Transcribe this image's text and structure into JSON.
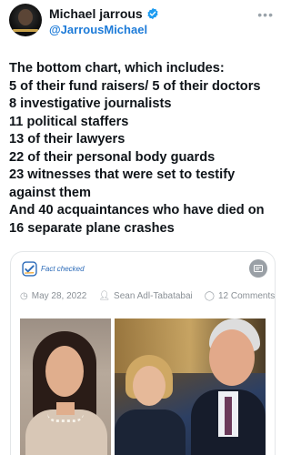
{
  "author": {
    "name": "Michael jarrous",
    "handle": "@JarrousMichael",
    "verified": true,
    "more_icon": "ellipsis-icon"
  },
  "tweet": {
    "lines": [
      "The bottom chart, which includes:",
      "5 of their fund raisers/ 5 of their doctors",
      "8 investigative journalists",
      "11 political staffers",
      "13 of their lawyers",
      "22 of their personal body guards",
      "23 witnesses that were set to testify",
      "against them",
      "And 40 acquaintances who have died on",
      "16 separate plane crashes"
    ]
  },
  "card": {
    "fact_checked_label": "Fact checked",
    "date": "May 28, 2022",
    "author": "Sean Adl-Tabatabai",
    "comments": "12 Comments",
    "share_icon": "share-icon"
  },
  "colors": {
    "handle": "#1d7bd8",
    "verified_badge": "#1d9bf0",
    "fact_check": "#2c6bb8"
  }
}
